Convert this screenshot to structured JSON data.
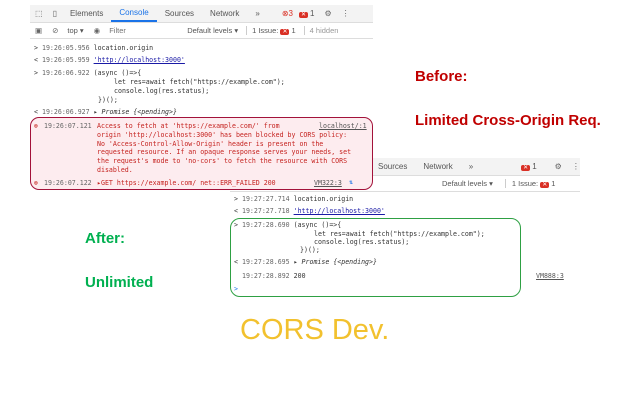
{
  "before_panel": {
    "tabs": [
      "Elements",
      "Console",
      "Sources",
      "Network",
      "»"
    ],
    "active_tab": "Console",
    "error_count": "3",
    "warn_count": "1",
    "context": "top ▾",
    "filter_placeholder": "Filter",
    "levels": "Default levels ▾",
    "issues_label": "1 Issue:",
    "issues_count": "1",
    "hidden": "4 hidden",
    "lines": [
      {
        "prefix": ">",
        "ts": "19:26:05.956",
        "text": "location.origin"
      },
      {
        "prefix": "<",
        "ts": "19:26:05.959",
        "text": "'http://localhost:3000'"
      },
      {
        "prefix": ">",
        "ts": "19:26:06.922",
        "text": "(async ()=>{"
      },
      {
        "text": "let res=await fetch(\"https://example.com\");"
      },
      {
        "text": "console.log(res.status);"
      },
      {
        "text": "})();"
      },
      {
        "prefix": "<",
        "ts": "19:26:06.927",
        "text": "▸ Promise {<pending>}"
      }
    ],
    "error": {
      "ts": "19:26:07.121",
      "lines": [
        "Access to fetch at 'https://example.com/' from",
        "origin 'http://localhost:3000' has been blocked by CORS policy:",
        "No 'Access-Control-Allow-Origin' header is present on the",
        "requested resource. If an opaque response serves your needs, set",
        "the request's mode to 'no-cors' to fetch the resource with CORS",
        "disabled."
      ],
      "source": "localhost/:1",
      "ts2": "19:26:07.122",
      "get_text": "▸GET https://example.com/ net::ERR_FAILED 200",
      "source2": "VM322:3"
    }
  },
  "after_panel": {
    "tabs": [
      "Sources",
      "Network",
      "»"
    ],
    "warn_count": "1",
    "levels": "Default levels ▾",
    "issues_label": "1 Issue:",
    "issues_count": "1",
    "lines": [
      {
        "prefix": ">",
        "ts": "19:27:27.714",
        "text": "location.origin"
      },
      {
        "prefix": "<",
        "ts": "19:27:27.718",
        "text": "'http://localhost:3000'"
      },
      {
        "prefix": ">",
        "ts": "19:27:28.690",
        "text": "(async ()=>{"
      },
      {
        "text": "let res=await fetch(\"https://example.com\");"
      },
      {
        "text": "console.log(res.status);"
      },
      {
        "text": "})();"
      },
      {
        "prefix": "<",
        "ts": "19:27:28.695",
        "text": "▸ Promise {<pending>}"
      },
      {
        "ts": "19:27:28.892",
        "text": "200"
      }
    ],
    "source": "VM888:3",
    "prompt": ">"
  },
  "labels": {
    "before": "Before:",
    "limited": "Limited Cross-Origin Req.",
    "after": "After:",
    "unlimited": "Unlimited",
    "brand": "CORS Dev."
  },
  "colors": {
    "before": "#c00000",
    "after": "#00b050",
    "brand": "#f2c12e"
  }
}
